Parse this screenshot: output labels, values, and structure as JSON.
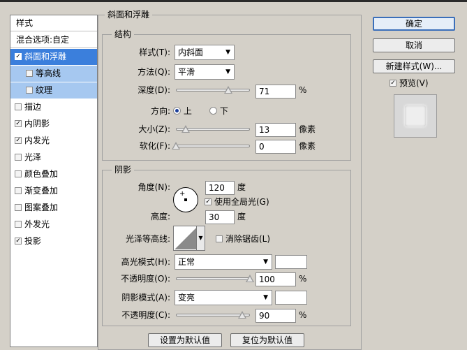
{
  "left_panel": {
    "header": "样式",
    "items": [
      {
        "label": "混合选项:自定",
        "type": "header",
        "checked": false
      },
      {
        "label": "斜面和浮雕",
        "checked": true,
        "selected": true
      },
      {
        "label": "等高线",
        "checked": false,
        "sub": true
      },
      {
        "label": "纹理",
        "checked": false,
        "sub": true
      },
      {
        "label": "描边",
        "checked": false
      },
      {
        "label": "内阴影",
        "checked": true
      },
      {
        "label": "内发光",
        "checked": true
      },
      {
        "label": "光泽",
        "checked": false
      },
      {
        "label": "颜色叠加",
        "checked": false
      },
      {
        "label": "渐变叠加",
        "checked": false
      },
      {
        "label": "图案叠加",
        "checked": false
      },
      {
        "label": "外发光",
        "checked": false
      },
      {
        "label": "投影",
        "checked": true
      }
    ]
  },
  "bevel": {
    "title": "斜面和浮雕",
    "structure": {
      "title": "结构",
      "style_label": "样式(T):",
      "style_value": "内斜面",
      "technique_label": "方法(Q):",
      "technique_value": "平滑",
      "depth_label": "深度(D):",
      "depth_value": "71",
      "depth_pct": 71,
      "depth_unit": "%",
      "direction_label": "方向:",
      "direction_up": "上",
      "direction_down": "下",
      "size_label": "大小(Z):",
      "size_value": "13",
      "size_pct": 13,
      "size_unit": "像素",
      "soften_label": "软化(F):",
      "soften_value": "0",
      "soften_pct": 0,
      "soften_unit": "像素"
    },
    "shading": {
      "title": "阴影",
      "angle_label": "角度(N):",
      "angle_value": "120",
      "angle_unit": "度",
      "global_light_label": "使用全局光(G)",
      "global_light_checked": true,
      "altitude_label": "高度:",
      "altitude_value": "30",
      "altitude_unit": "度",
      "gloss_contour_label": "光泽等高线:",
      "anti_alias_label": "消除锯齿(L)",
      "anti_alias_checked": false,
      "highlight_mode_label": "高光模式(H):",
      "highlight_mode_value": "正常",
      "highlight_color": "#ffffff",
      "highlight_opacity_label": "不透明度(O):",
      "highlight_opacity_value": "100",
      "highlight_opacity_pct": 100,
      "highlight_opacity_unit": "%",
      "shadow_mode_label": "阴影模式(A):",
      "shadow_mode_value": "变亮",
      "shadow_color": "#ffffff",
      "shadow_opacity_label": "不透明度(C):",
      "shadow_opacity_value": "90",
      "shadow_opacity_pct": 90,
      "shadow_opacity_unit": "%"
    },
    "make_default": "设置为默认值",
    "reset_default": "复位为默认值"
  },
  "buttons": {
    "ok": "确定",
    "cancel": "取消",
    "new_style": "新建样式(W)...",
    "preview_label": "预览(V)",
    "preview_checked": true
  }
}
